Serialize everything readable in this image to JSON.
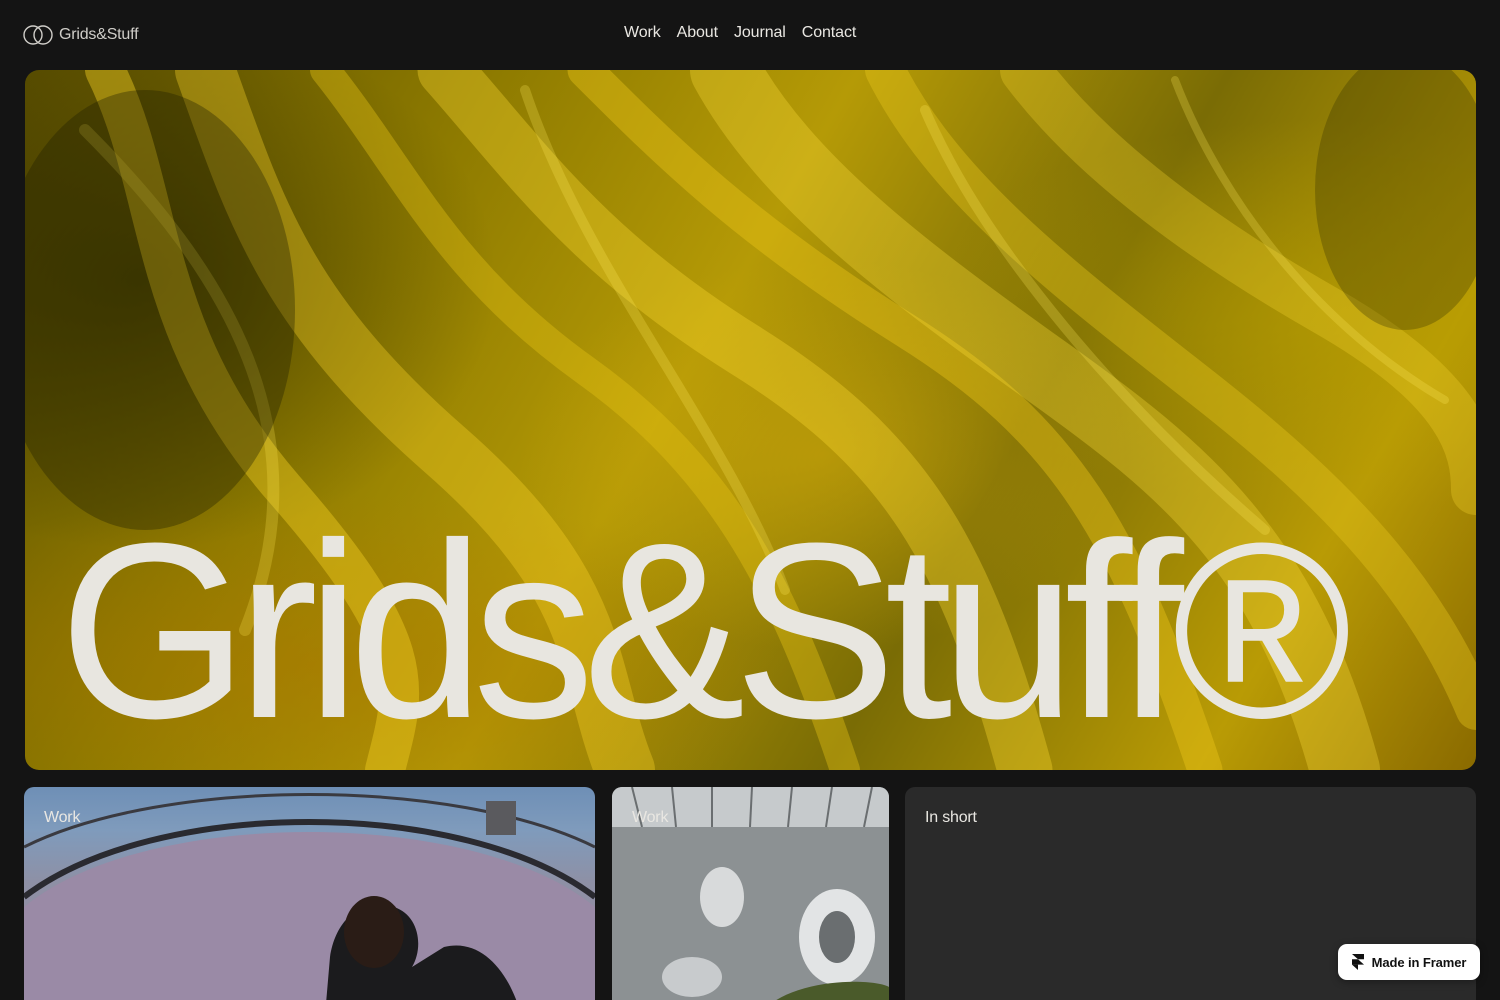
{
  "header": {
    "logo_text": "Grids&Stuff",
    "logo_icon": "interlocking-circles-icon",
    "nav": [
      {
        "label": "Work"
      },
      {
        "label": "About"
      },
      {
        "label": "Journal"
      },
      {
        "label": "Contact"
      }
    ]
  },
  "hero": {
    "title": "Grids&Stuff®",
    "image": "yellow-ink-smoke-image"
  },
  "cards": [
    {
      "label": "Work",
      "image": "portrait-man-photo"
    },
    {
      "label": "Work",
      "image": "chrome-eggs-on-moss-render"
    },
    {
      "label": "In short"
    }
  ],
  "badge": {
    "label": "Made in Framer",
    "icon": "framer-logo-icon"
  },
  "colors": {
    "background": "#141414",
    "text": "#e9e7e2",
    "hero_yellow": "#b59a06",
    "card_dark": "#2a2a2a",
    "badge_bg": "#ffffff"
  }
}
